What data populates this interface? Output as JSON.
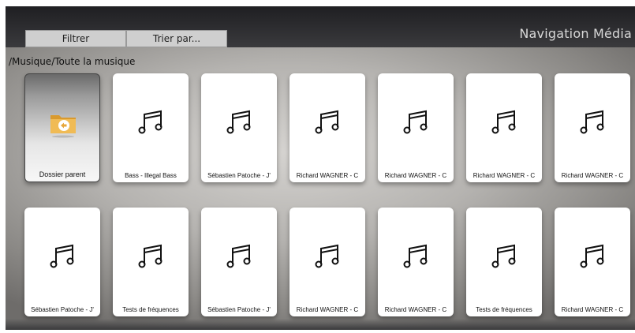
{
  "toolbar": {
    "filter_label": "Filtrer",
    "sort_label": "Trier par..."
  },
  "header": {
    "title": "Navigation Média"
  },
  "breadcrumb": "/Musique/Toute la musique",
  "tiles": [
    {
      "label": "Dossier parent",
      "icon": "folder-back-icon"
    },
    {
      "label": "Bass - Illegal Bass",
      "icon": "music-note-icon"
    },
    {
      "label": "Sébastien Patoche - J'",
      "icon": "music-note-icon"
    },
    {
      "label": "Richard WAGNER - C",
      "icon": "music-note-icon"
    },
    {
      "label": "Richard WAGNER - C",
      "icon": "music-note-icon"
    },
    {
      "label": "Richard WAGNER - C",
      "icon": "music-note-icon"
    },
    {
      "label": "Richard WAGNER - C",
      "icon": "music-note-icon"
    },
    {
      "label": "Sébastien Patoche - J'",
      "icon": "music-note-icon"
    },
    {
      "label": "Tests de fréquences",
      "icon": "music-note-icon"
    },
    {
      "label": "Sébastien Patoche - J'",
      "icon": "music-note-icon"
    },
    {
      "label": "Richard WAGNER - C",
      "icon": "music-note-icon"
    },
    {
      "label": "Richard WAGNER - C",
      "icon": "music-note-icon"
    },
    {
      "label": "Tests de fréquences",
      "icon": "music-note-icon"
    },
    {
      "label": "Richard WAGNER - C",
      "icon": "music-note-icon"
    }
  ],
  "colors": {
    "topbar": "#2c2c2f",
    "tile_bg": "#ffffff",
    "folder": "#e8b04a"
  }
}
